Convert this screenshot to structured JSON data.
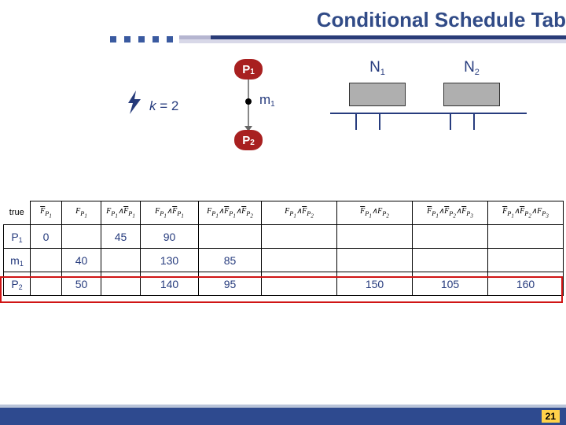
{
  "title": "Conditional Schedule Tab",
  "page_number": "21",
  "diagram": {
    "k_label_var": "k",
    "k_label_eq": " = 2",
    "node1": "P",
    "node1_sub": "1",
    "node2": "P",
    "node2_sub": "2",
    "edge_label": "m",
    "edge_label_sub": "1",
    "proc1": "N",
    "proc1_sub": "1",
    "proc2": "N",
    "proc2_sub": "2"
  },
  "table": {
    "header_first": "true",
    "rows": [
      {
        "label": "P",
        "label_sub": "1",
        "cells": [
          "0",
          "",
          "45",
          "90",
          "",
          "",
          "",
          "",
          ""
        ]
      },
      {
        "label": "m",
        "label_sub": "1",
        "cells": [
          "",
          "40",
          "",
          "130",
          "85",
          "",
          "",
          "",
          ""
        ]
      },
      {
        "label": "P",
        "label_sub": "2",
        "cells": [
          "",
          "50",
          "",
          "140",
          "95",
          "",
          "150",
          "105",
          "160"
        ]
      }
    ]
  },
  "chart_data": {
    "type": "table",
    "title": "Conditional Schedule Tab",
    "k": 2,
    "processes": [
      "P1",
      "m1",
      "P2"
    ],
    "nodes": [
      "N1",
      "N2"
    ],
    "notes": "Column headers are Boolean guard formulas over F_{P_i} (combinations of F and F-bar for P1..P3); exact formulas include: F̄_{P1}, F_{P1}, F_{P1}∧F̄_{P1}, F_{P1}∧F̄_{P1}∧F̄_{P2}, F_{P1}∧F̄_{P2}, F̄_{P1}∧F_{P2}, F̄_{P1}∧F̄_{P2}∧F̄_{P3}, F̄_{P1}∧F̄_{P2}∧F_{P3}",
    "rows": {
      "P1": {
        "true": 0,
        "col3": 45,
        "col4": 90
      },
      "m1": {
        "col2": 40,
        "col4": 130,
        "col5": 85
      },
      "P2": {
        "col2": 50,
        "col4": 140,
        "col5": 95,
        "col7": 150,
        "col8": 105,
        "col9": 160
      }
    }
  }
}
